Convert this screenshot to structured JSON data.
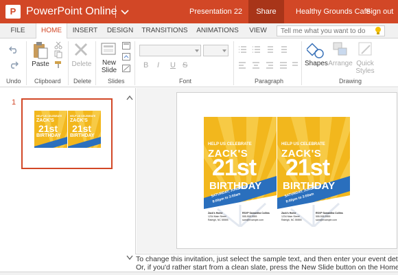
{
  "titlebar": {
    "app_icon_letter": "P",
    "app_name": "PowerPoint Online",
    "document_name": "Presentation 22",
    "share_label": "Share",
    "user_name": "Healthy Grounds Cafe",
    "sign_out_label": "Sign out"
  },
  "tabs": [
    {
      "label": "FILE"
    },
    {
      "label": "HOME"
    },
    {
      "label": "INSERT"
    },
    {
      "label": "DESIGN"
    },
    {
      "label": "TRANSITIONS"
    },
    {
      "label": "ANIMATIONS"
    },
    {
      "label": "VIEW"
    }
  ],
  "tell_me": {
    "placeholder": "Tell me what you want to do"
  },
  "ribbon": {
    "groups": {
      "undo": "Undo",
      "clipboard": "Clipboard",
      "delete": "Delete",
      "slides": "Slides",
      "font": "Font",
      "paragraph": "Paragraph",
      "drawing": "Drawing"
    },
    "buttons": {
      "paste": "Paste",
      "delete": "Delete",
      "new_slide_line1": "New",
      "new_slide_line2": "Slide",
      "shapes": "Shapes",
      "arrange": "Arrange",
      "quick_styles_line1": "Quick",
      "quick_styles_line2": "Styles"
    },
    "font_buttons": {
      "bold": "B",
      "italic": "I",
      "underline": "U",
      "strike": "S"
    }
  },
  "slides_panel": {
    "slide_number": "1"
  },
  "invitation": {
    "line1": "HELP US CELEBRATE",
    "line2": "ZACK'S",
    "line3": "21st",
    "line4": "BIRTHDAY",
    "band_line1": "SATURDAY, JUNE 6TH",
    "band_line2": "8:00pm to 3:00am",
    "addr_left_1": "Zack's Home",
    "addr_left_2": "1234 Main Street",
    "addr_left_3": "Raleigh, NC 55555",
    "addr_right_1": "RSVP Samantha Collins",
    "addr_right_2": "555.555.5555",
    "addr_right_3": "sam@example.com"
  },
  "notes": {
    "line1": "To change this invitation, just select the sample text, and then enter your event details.",
    "line2": "Or, if you'd rather start from a clean slate, press the New Slide button on the Home tab."
  },
  "colors": {
    "brand": "#d24726",
    "share_bg": "#a83519",
    "card_yellow": "#f2b71d",
    "card_blue": "#2a6fbd"
  },
  "icons": [
    "app-logo-icon",
    "chevron-down-icon",
    "lightbulb-icon",
    "undo-icon",
    "redo-icon",
    "paste-icon",
    "cut-icon",
    "copy-icon",
    "format-painter-icon",
    "delete-icon",
    "new-slide-icon",
    "layout-icon",
    "reset-icon",
    "hide-slide-icon",
    "shapes-icon",
    "arrange-icon",
    "quick-styles-icon",
    "scroll-up-icon",
    "scroll-down-icon"
  ]
}
